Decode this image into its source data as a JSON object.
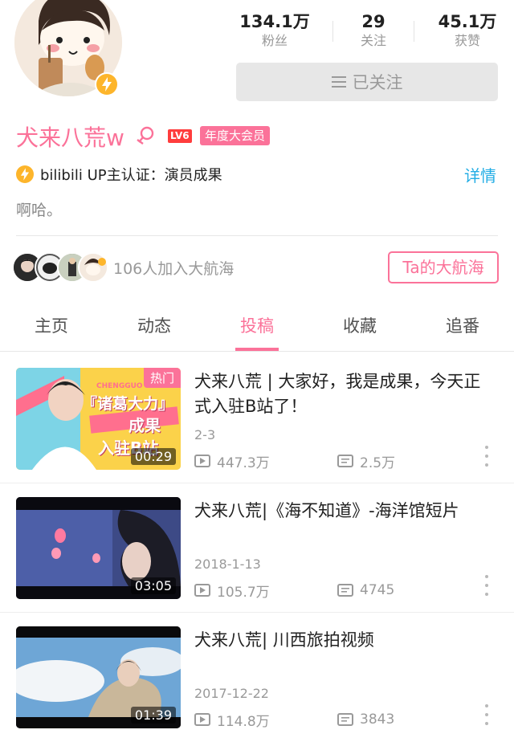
{
  "profile": {
    "followers_count": "134.1万",
    "followers_label": "粉丝",
    "following_count": "29",
    "following_label": "关注",
    "likes_count": "45.1万",
    "likes_label": "获赞",
    "follow_button_label": "已关注",
    "name": "犬来八荒w",
    "level_badge": "LV6",
    "vip_badge": "年度大会员",
    "verification": "bilibili UP主认证：演员成果",
    "detail_link": "详情",
    "signature": "啊哈。",
    "guard_count_text": "106人加入大航海",
    "guard_button": "Ta的大航海"
  },
  "tabs": [
    {
      "label": "主页"
    },
    {
      "label": "动态"
    },
    {
      "label": "投稿"
    },
    {
      "label": "收藏"
    },
    {
      "label": "追番"
    }
  ],
  "active_tab": "投稿",
  "videos": [
    {
      "title": "犬来八荒 | 大家好，我是成果，今天正式入驻B站了！",
      "date": "2-3",
      "views": "447.3万",
      "danmaku": "2.5万",
      "duration": "00:29",
      "hot_tag": "热门",
      "thumb_text": [
        "『诸葛大力』",
        "成果",
        "入驻B站"
      ],
      "thumb_small": "CHENGGUO"
    },
    {
      "title": "犬来八荒|《海不知道》-海洋馆短片",
      "date": "2018-1-13",
      "views": "105.7万",
      "danmaku": "4745",
      "duration": "03:05"
    },
    {
      "title": "犬来八荒| 川西旅拍视频",
      "date": "2017-12-22",
      "views": "114.8万",
      "danmaku": "3843",
      "duration": "01:39"
    }
  ],
  "colors": {
    "accent": "#fb7299",
    "link": "#23ade5",
    "level": "#ff3d3d",
    "bolt": "#fdb52b"
  },
  "icons": [
    "lightning-icon",
    "female-icon",
    "menu-lines-icon",
    "play-icon",
    "danmaku-icon",
    "more-vert-icon"
  ]
}
